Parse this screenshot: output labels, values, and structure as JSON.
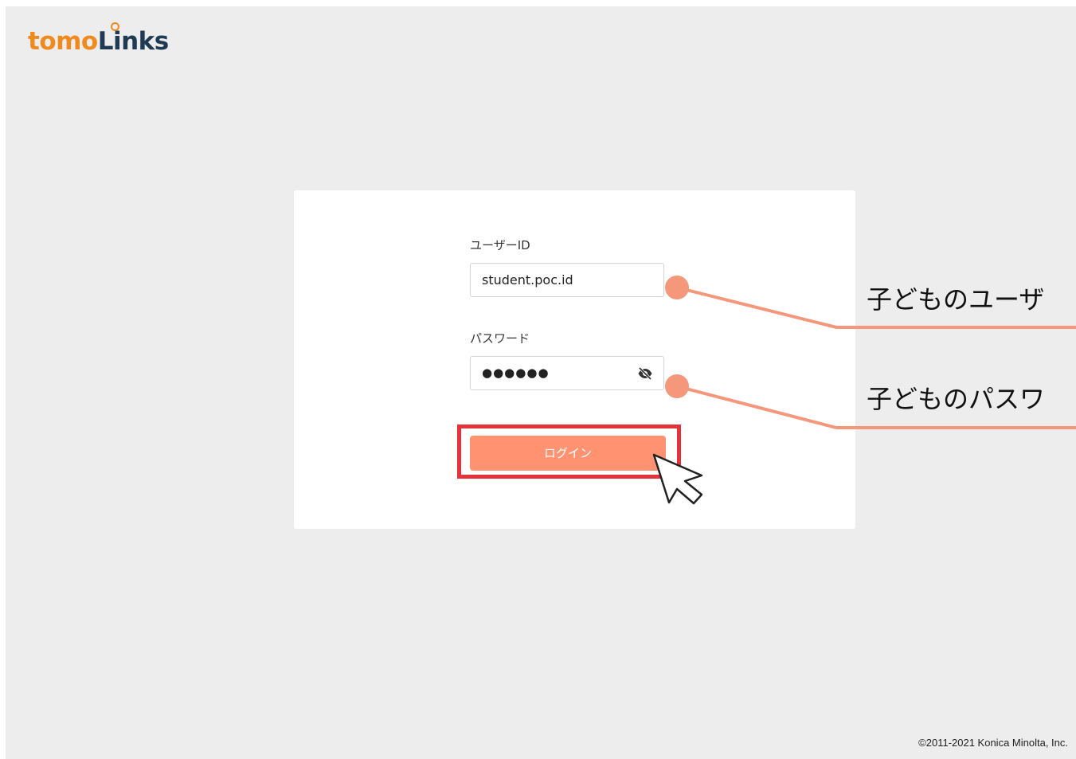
{
  "brand": {
    "logo_part1": "tomo",
    "logo_part2": "Links",
    "color_primary": "#f08a1f",
    "color_secondary": "#1f3a53"
  },
  "login_form": {
    "user_id_label": "ユーザーID",
    "user_id_value": "student.poc.id",
    "password_label": "パスワード",
    "password_masked": "●●●●●●",
    "password_toggle_icon": "eye-slash-icon",
    "login_button_label": "ログイン",
    "accent_color": "#ff9270"
  },
  "annotations": {
    "user_id_callout": "子どものユーザ",
    "password_callout": "子どものパスワ",
    "highlight_color": "#e6323b",
    "callout_color": "#f4977a",
    "pointer_icon": "cursor-arrow-icon"
  },
  "footer": {
    "copyright": "©2011-2021 Konica Minolta, Inc."
  }
}
